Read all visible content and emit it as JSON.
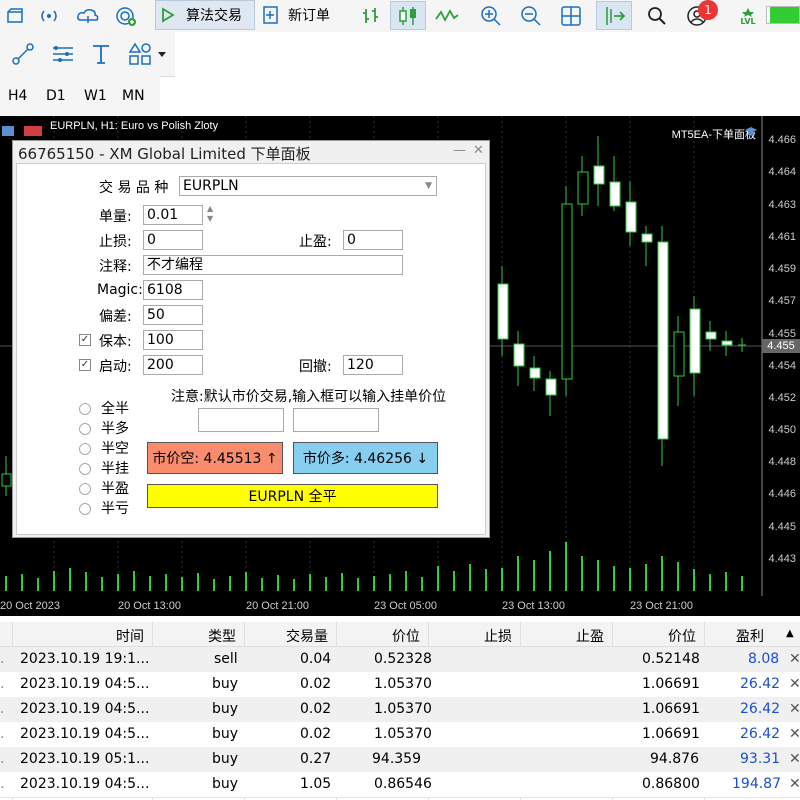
{
  "toolbar": {
    "algo_trading_label": "算法交易",
    "new_order_label": "新订单",
    "notification_count": "1",
    "lvl_label": "LVL"
  },
  "timeframes": [
    "H4",
    "D1",
    "W1",
    "MN"
  ],
  "chart": {
    "header": "EURPLN, H1:  Euro vs Polish Zloty",
    "ea_label": "MT5EA-下单面板",
    "price_labels": [
      "4.466",
      "4.464",
      "4.463",
      "4.461",
      "4.459",
      "4.457",
      "4.455",
      "4.454",
      "4.452",
      "4.450",
      "4.448",
      "4.446",
      "4.445",
      "4.443"
    ],
    "current_price": "4.455",
    "time_labels": [
      "20 Oct 2023",
      "20 Oct 13:00",
      "20 Oct 21:00",
      "23 Oct 05:00",
      "23 Oct 13:00",
      "23 Oct 21:00"
    ]
  },
  "panel": {
    "title": "66765150 - XM Global Limited 下单面板",
    "symbol_label": "交 易 品 种",
    "symbol_value": "EURPLN",
    "volume_label": "单量:",
    "volume_value": "0.01",
    "sl_label": "止损:",
    "sl_value": "0",
    "tp_label": "止盈:",
    "tp_value": "0",
    "comment_label": "注释:",
    "comment_value": "不才编程",
    "magic_label": "Magic:",
    "magic_value": "6108",
    "deviation_label": "偏差:",
    "deviation_value": "50",
    "breakeven_label": "保本:",
    "breakeven_value": "100",
    "breakeven_checked": true,
    "activate_label": "启动:",
    "activate_value": "200",
    "activate_checked": true,
    "retrace_label": "回撤:",
    "retrace_value": "120",
    "note": "注意:默认市价交易,输入框可以输入挂单价位",
    "radio_options": [
      "全半",
      "半多",
      "半空",
      "半挂",
      "半盈",
      "半亏"
    ],
    "sell_button": "市价空: 4.45513 ↑",
    "buy_button": "市价多: 4.46256 ↓",
    "close_all_button": "EURPLN 全平",
    "sell_color": "#fa8c6e",
    "buy_color": "#87cef0",
    "close_color": "#ffff00"
  },
  "positions": {
    "columns": [
      "时间",
      "类型",
      "交易量",
      "价位",
      "止损",
      "止盈",
      "价位",
      "盈利"
    ],
    "rows": [
      {
        "time": "2023.10.19 19:1...",
        "type": "sell",
        "volume": "0.04",
        "open_price": "0.52328",
        "sl": "",
        "tp": "",
        "price": "0.52148",
        "profit": "8.08"
      },
      {
        "time": "2023.10.19 04:5...",
        "type": "buy",
        "volume": "0.02",
        "open_price": "1.05370",
        "sl": "",
        "tp": "",
        "price": "1.06691",
        "profit": "26.42"
      },
      {
        "time": "2023.10.19 04:5...",
        "type": "buy",
        "volume": "0.02",
        "open_price": "1.05370",
        "sl": "",
        "tp": "",
        "price": "1.06691",
        "profit": "26.42"
      },
      {
        "time": "2023.10.19 04:5...",
        "type": "buy",
        "volume": "0.02",
        "open_price": "1.05370",
        "sl": "",
        "tp": "",
        "price": "1.06691",
        "profit": "26.42"
      },
      {
        "time": "2023.10.19 05:1...",
        "type": "buy",
        "volume": "0.27",
        "open_price": "94.359",
        "sl": "",
        "tp": "",
        "price": "94.876",
        "profit": "93.31"
      },
      {
        "time": "2023.10.19 04:5...",
        "type": "buy",
        "volume": "1.05",
        "open_price": "0.86546",
        "sl": "",
        "tp": "",
        "price": "0.86800",
        "profit": "194.87"
      }
    ]
  }
}
